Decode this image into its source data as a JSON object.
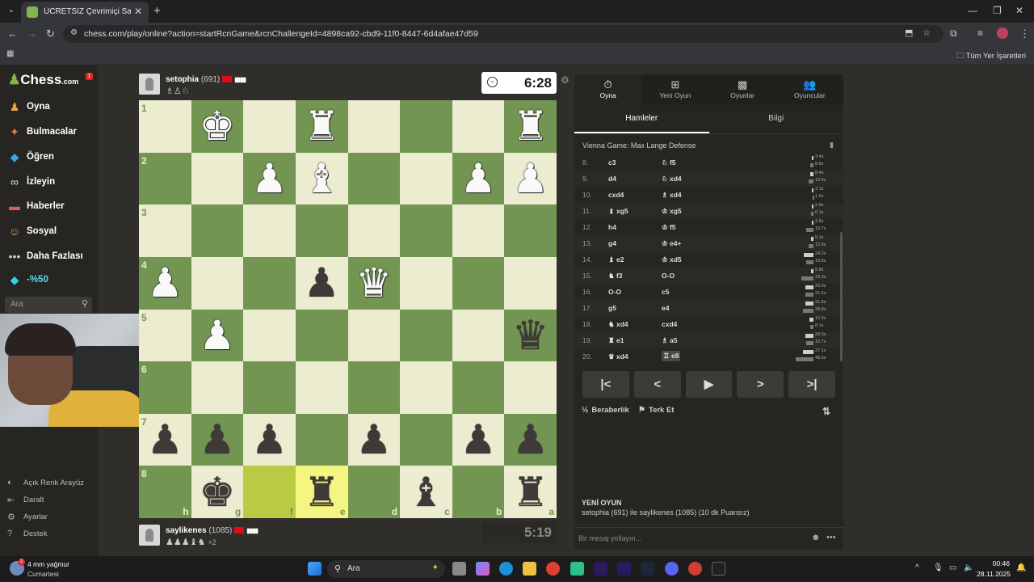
{
  "browser": {
    "tab_title": "ÜCRETSİZ Çevrimiçi Satranç Oy",
    "url": "chess.com/play/online?action=startRcnGame&rcnChallengeId=4898ca92-cbd9-11f0-8447-6d4afae47d59",
    "bookmarks_all": "Tüm Yer İşaretleri"
  },
  "sidebar": {
    "logo": "Chess",
    "logo_suffix": ".com",
    "notif": "1",
    "items": [
      {
        "label": "Oyna",
        "icon": "play-icon"
      },
      {
        "label": "Bulmacalar",
        "icon": "puzzle-icon"
      },
      {
        "label": "Öğren",
        "icon": "learn-icon"
      },
      {
        "label": "İzleyin",
        "icon": "binoculars-icon"
      },
      {
        "label": "Haberler",
        "icon": "news-icon"
      },
      {
        "label": "Sosyal",
        "icon": "social-icon"
      },
      {
        "label": "Daha Fazlası",
        "icon": "more-icon"
      },
      {
        "label": "-%50",
        "icon": "diamond-icon"
      }
    ],
    "search_placeholder": "Ara",
    "bottom": [
      {
        "label": "Açık Renk Arayüz",
        "icon": "theme-icon"
      },
      {
        "label": "Daralt",
        "icon": "collapse-icon"
      },
      {
        "label": "Ayarlar",
        "icon": "settings-icon"
      },
      {
        "label": "Destek",
        "icon": "help-icon"
      }
    ]
  },
  "top_player": {
    "name": "setophia",
    "rating": "(691)",
    "captured": "♗♙♘",
    "clock": "6:28"
  },
  "bottom_player": {
    "name": "saylikenes",
    "rating": "(1085)",
    "captured": "♟♟♟♝♞",
    "advantage": "+2",
    "clock": "5:19"
  },
  "board": {
    "ranks": [
      "1",
      "2",
      "3",
      "4",
      "5",
      "6",
      "7",
      "8"
    ],
    "files": [
      "h",
      "g",
      "f",
      "e",
      "d",
      "c",
      "b",
      "a"
    ],
    "rows": [
      [
        "",
        "wK",
        "",
        "wR",
        "",
        "",
        "",
        "wR"
      ],
      [
        "",
        "",
        "wP",
        "wB",
        "",
        "",
        "wP",
        "wP"
      ],
      [
        "",
        "",
        "",
        "",
        "",
        "",
        "",
        ""
      ],
      [
        "wP",
        "",
        "",
        "bP",
        "wQ",
        "",
        "",
        ""
      ],
      [
        "",
        "wP",
        "",
        "",
        "",
        "",
        "",
        "bQ"
      ],
      [
        "",
        "",
        "",
        "",
        "",
        "",
        "",
        ""
      ],
      [
        "bP",
        "bP",
        "bP",
        "",
        "bP",
        "",
        "bP",
        "bP"
      ],
      [
        "",
        "bK",
        "",
        "bR",
        "",
        "bB",
        "",
        "bR"
      ]
    ],
    "highlights": [
      [
        7,
        2,
        "hl2"
      ],
      [
        7,
        3,
        "hl"
      ]
    ]
  },
  "panel": {
    "tabs": [
      {
        "label": "Oyna",
        "icon": "stopwatch-icon"
      },
      {
        "label": "Yeni Oyun",
        "icon": "new-game-icon"
      },
      {
        "label": "Oyunlar",
        "icon": "games-icon"
      },
      {
        "label": "Oyuncular",
        "icon": "players-icon"
      }
    ],
    "subtabs": [
      "Hamleler",
      "Bilgi"
    ],
    "opening": "Vienna Game: Max Lange Defense",
    "moves": [
      {
        "n": "8.",
        "w": "c3",
        "b": "♘ f5",
        "tw": "3.4s",
        "tb": "8.6s",
        "fw": 0.05,
        "fb": 0.1
      },
      {
        "n": "9.",
        "w": "d4",
        "b": "♘ xd4",
        "tw": "8.4s",
        "tb": "13.4s",
        "fw": 0.1,
        "fb": 0.15
      },
      {
        "n": "10.",
        "w": "cxd4",
        "b": "♗ xd4",
        "tw": "3.1s",
        "tb": "1.6s",
        "fw": 0.05,
        "fb": 0.03
      },
      {
        "n": "11.",
        "w": "♝ xg5",
        "b": "♔ xg5",
        "tw": "2.6s",
        "tb": "6.1s",
        "fw": 0.04,
        "fb": 0.08
      },
      {
        "n": "12.",
        "w": "h4",
        "b": "♔ f5",
        "tw": "3.8s",
        "tb": "19.7s",
        "fw": 0.05,
        "fb": 0.22
      },
      {
        "n": "13.",
        "w": "g4",
        "b": "♔ e4+",
        "tw": "5.1s",
        "tb": "12.9s",
        "fw": 0.07,
        "fb": 0.15
      },
      {
        "n": "14.",
        "w": "♝ e2",
        "b": "♔ xd5",
        "tw": "24.2s",
        "tb": "19.9s",
        "fw": 0.3,
        "fb": 0.23
      },
      {
        "n": "15.",
        "w": "♞ f3",
        "b": "O-O",
        "tw": "5.8s",
        "tb": "33.9s",
        "fw": 0.08,
        "fb": 0.38
      },
      {
        "n": "16.",
        "w": "O-O",
        "b": "c5",
        "tw": "20.9s",
        "tb": "21.5s",
        "fw": 0.25,
        "fb": 0.25
      },
      {
        "n": "17.",
        "w": "g5",
        "b": "e4",
        "tw": "21.6s",
        "tb": "28.9s",
        "fw": 0.26,
        "fb": 0.33
      },
      {
        "n": "18.",
        "w": "♞ xd4",
        "b": "cxd4",
        "tw": "10.9s",
        "tb": "8.1s",
        "fw": 0.13,
        "fb": 0.1
      },
      {
        "n": "19.",
        "w": "♜ e1",
        "b": "♗ a5",
        "tw": "20.3s",
        "tb": "19.7s",
        "fw": 0.24,
        "fb": 0.23
      },
      {
        "n": "20.",
        "w": "♛ xd4",
        "b": "♖ e8",
        "tw": "27.1s",
        "tb": "48.5s",
        "fw": 0.32,
        "fb": 0.55
      }
    ],
    "draw": "Beraberlik",
    "resign": "Terk Et",
    "new_game_title": "YENİ OYUN",
    "new_game_desc": "setophia (691) ile saylikenes (1085) (10 dk Puansız)",
    "chat_placeholder": "Bir mesaj yollayın..."
  },
  "taskbar": {
    "weather": "4 mm yağmur",
    "weather_sub": "Cumartesi",
    "search": "Ara",
    "time": "00:46",
    "date": "28.11.2025"
  }
}
